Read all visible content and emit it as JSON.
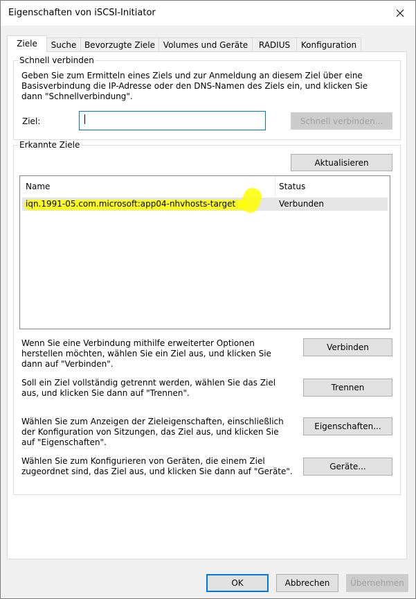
{
  "window": {
    "title": "Eigenschaften von iSCSI-Initiator"
  },
  "tabs": [
    {
      "label": "Ziele"
    },
    {
      "label": "Suche"
    },
    {
      "label": "Bevorzugte Ziele"
    },
    {
      "label": "Volumes und Geräte"
    },
    {
      "label": "RADIUS"
    },
    {
      "label": "Konfiguration"
    }
  ],
  "quick_connect": {
    "legend": "Schnell verbinden",
    "description": "Geben Sie zum Ermitteln eines Ziels und zur Anmeldung an diesem Ziel über eine Basisverbindung die IP-Adresse oder den DNS-Namen des Ziels ein, und klicken Sie dann \"Schnellverbindung\".",
    "target_label": "Ziel:",
    "target_value": "",
    "button": "Schnell verbinden..."
  },
  "discovered": {
    "legend": "Erkannte Ziele",
    "refresh_button": "Aktualisieren",
    "columns": {
      "name": "Name",
      "status": "Status"
    },
    "rows": [
      {
        "name": "iqn.1991-05.com.microsoft:app04-nhvhosts-target",
        "status": "Verbunden"
      }
    ],
    "connect_text": "Wenn Sie eine Verbindung mithilfe erweiterter Optionen herstellen möchten, wählen Sie ein Ziel aus, und klicken Sie dann auf \"Verbinden\".",
    "connect_button": "Verbinden",
    "disconnect_text": "Soll ein Ziel vollständig getrennt werden, wählen Sie das Ziel aus, und klicken Sie dann auf \"Trennen\".",
    "disconnect_button": "Trennen",
    "properties_text": "Wählen Sie zum Anzeigen der Zieleigenschaften, einschließlich der Konfiguration von Sitzungen, das Ziel aus, und klicken Sie auf \"Eigenschaften\".",
    "properties_button": "Eigenschaften...",
    "devices_text": "Wählen Sie zum Konfigurieren von Geräten, die einem Ziel zugeordnet sind, das Ziel aus, und klicken Sie dann auf \"Geräte\".",
    "devices_button": "Geräte..."
  },
  "footer": {
    "ok": "OK",
    "cancel": "Abbrechen",
    "apply": "Übernehmen"
  },
  "colors": {
    "highlight": "#ffff00",
    "accent": "#0078d7"
  }
}
